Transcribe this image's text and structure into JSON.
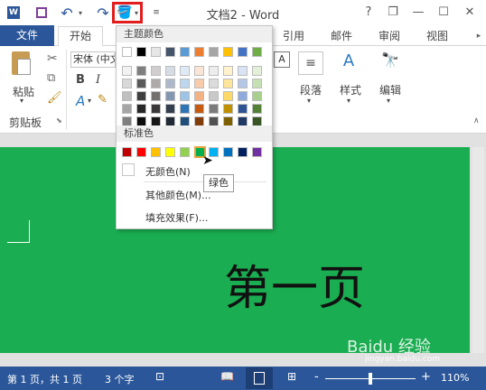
{
  "window": {
    "title": "文档2 - Word",
    "help": "?",
    "minimize": "—",
    "restore": "❐",
    "close": "✕"
  },
  "tabs": {
    "file": "文件",
    "home": "开始",
    "references": "引用",
    "mailings": "邮件",
    "review": "审阅",
    "view": "视图"
  },
  "ribbon": {
    "paste": "粘贴",
    "clipboard_group": "剪贴板",
    "font_name": "宋体 (中文",
    "bold": "B",
    "italic": "I",
    "paragraph": "段落",
    "styles": "样式",
    "editing": "编辑"
  },
  "dropdown": {
    "theme_colors_header": "主题颜色",
    "standard_colors_header": "标准色",
    "no_color": "无颜色(N)",
    "more_colors": "其他颜色(M)...",
    "fill_effects": "填充效果(F)...",
    "tooltip": "绿色",
    "theme_columns": [
      [
        "#ffffff",
        "#f2f2f2",
        "#d8d8d8",
        "#bfbfbf",
        "#a5a5a5",
        "#7f7f7f"
      ],
      [
        "#000000",
        "#7f7f7f",
        "#595959",
        "#3f3f3f",
        "#262626",
        "#0c0c0c"
      ],
      [
        "#e7e6e6",
        "#d0cece",
        "#aeaaaa",
        "#757070",
        "#3a3838",
        "#161616"
      ],
      [
        "#44546a",
        "#d6dce4",
        "#adb9ca",
        "#8497b0",
        "#333f4f",
        "#222a35"
      ],
      [
        "#5b9bd5",
        "#deebf6",
        "#bdd7ee",
        "#9dc3e6",
        "#2e75b5",
        "#1e4e79"
      ],
      [
        "#ed7d31",
        "#fbe5d5",
        "#f7cbac",
        "#f4b183",
        "#c55a11",
        "#833c0b"
      ],
      [
        "#a5a5a5",
        "#ededed",
        "#dbdbdb",
        "#c9c9c9",
        "#7b7b7b",
        "#525252"
      ],
      [
        "#ffc000",
        "#fff2cc",
        "#fee599",
        "#ffd965",
        "#bf9000",
        "#7f6000"
      ],
      [
        "#4472c4",
        "#dae3f3",
        "#b4c7e7",
        "#8faadc",
        "#2f5496",
        "#1f3864"
      ],
      [
        "#70ad47",
        "#e2efd9",
        "#c5e0b3",
        "#a8d08d",
        "#538135",
        "#375623"
      ]
    ],
    "standard_colors": [
      "#c00000",
      "#ff0000",
      "#ffc000",
      "#ffff00",
      "#92d050",
      "#00b050",
      "#00b0f0",
      "#0070c0",
      "#002060",
      "#7030a0"
    ]
  },
  "document": {
    "page_color": "#1aad51",
    "heading": "第一页"
  },
  "statusbar": {
    "page_info": "第 1 页，共 1 页",
    "word_count": "3 个字",
    "zoom": "110%",
    "minus": "-",
    "plus": "+"
  },
  "watermark": {
    "brand": "Baidu 经验",
    "url": "jingyan.baidu.com"
  }
}
